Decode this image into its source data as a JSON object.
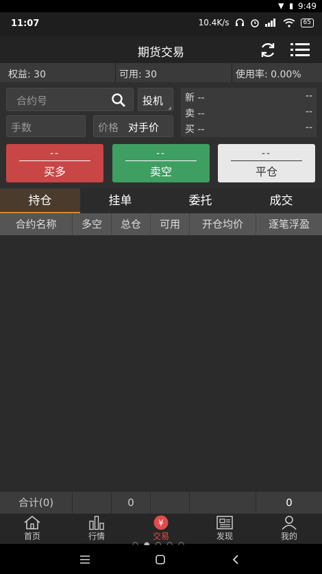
{
  "system": {
    "top_time": "9:49",
    "status_time": "11:07",
    "net_speed": "10.4K/s",
    "battery": "65"
  },
  "app": {
    "title": "期货交易"
  },
  "info": {
    "equity": "权益: 30",
    "available": "可用: 30",
    "usage": "使用率: 0.00%"
  },
  "order_form": {
    "contract_placeholder": "合约号",
    "type_label": "投机",
    "qty_placeholder": "手数",
    "price_label": "价格",
    "price_value": "对手价"
  },
  "quote": {
    "rows": [
      {
        "label": "新",
        "left": "--",
        "right": "--"
      },
      {
        "label": "卖",
        "left": "--",
        "right": "--"
      },
      {
        "label": "买",
        "left": "--",
        "right": "--"
      }
    ]
  },
  "actions": {
    "buy": {
      "price": "--",
      "label": "买多"
    },
    "sell": {
      "price": "--",
      "label": "卖空"
    },
    "close": {
      "price": "--",
      "label": "平仓"
    }
  },
  "tabs": [
    "持仓",
    "挂单",
    "委托",
    "成交"
  ],
  "active_tab": "持仓",
  "table": {
    "headers": [
      "合约名称",
      "多空",
      "总仓",
      "可用",
      "开仓均价",
      "逐笔浮盈"
    ]
  },
  "summary": {
    "total_label": "合计(0)",
    "total_qty": "0",
    "total_pnl": "0"
  },
  "bottom_nav": [
    {
      "label": "首页",
      "icon": "home-icon"
    },
    {
      "label": "行情",
      "icon": "chart-bars-icon"
    },
    {
      "label": "交易",
      "icon": "yen-icon"
    },
    {
      "label": "发现",
      "icon": "news-icon"
    },
    {
      "label": "我的",
      "icon": "user-icon"
    }
  ],
  "active_nav": "交易",
  "colors": {
    "buy": "#c94646",
    "sell": "#3f9e62",
    "close": "#e8e8e8",
    "accent": "#d48a2b",
    "active_nav": "#e04b4b"
  }
}
